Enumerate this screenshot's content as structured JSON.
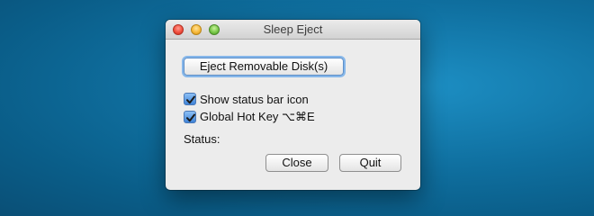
{
  "window": {
    "title": "Sleep Eject"
  },
  "buttons": {
    "eject_label": "Eject Removable Disk(s)",
    "close_label": "Close",
    "quit_label": "Quit"
  },
  "options": [
    {
      "label": "Show status bar icon",
      "checked": true
    },
    {
      "label": "Global Hot Key ⌥⌘E",
      "checked": true
    }
  ],
  "status": {
    "label": "Status:",
    "value": ""
  },
  "colors": {
    "desktop_background": "#0f6f9f",
    "window_background": "#ececec",
    "checkbox_accent": "#3f84d8",
    "focus_ring": "#86b7ea",
    "close_light": "#f2503f",
    "minimize_light": "#f7b93a",
    "zoom_light": "#79c94a"
  },
  "icons": {
    "close": "close-dot-icon",
    "minimize": "minimize-dot-icon",
    "zoom": "zoom-dot-icon",
    "check": "checkmark-icon"
  }
}
